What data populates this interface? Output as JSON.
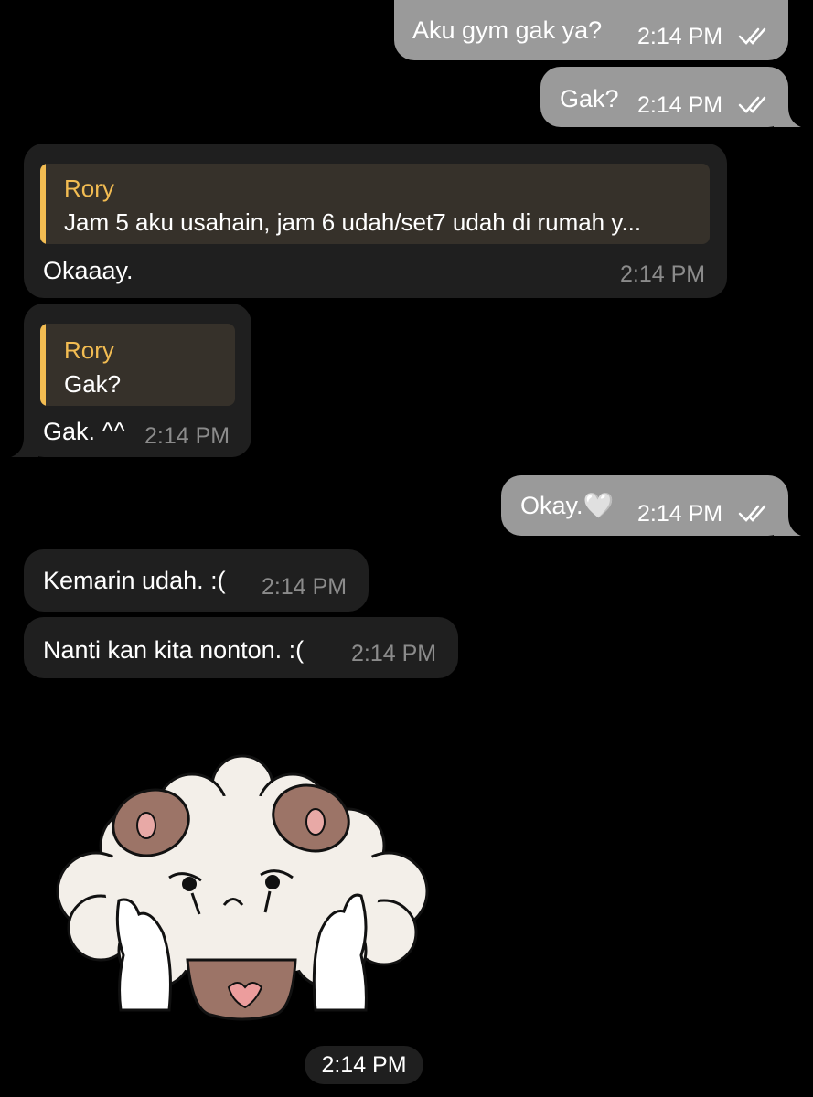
{
  "colors": {
    "background": "#000000",
    "outgoing_bubble": "#9a9a9a",
    "incoming_bubble": "#1f1f1f",
    "reply_accent": "#f2bc52",
    "reply_background": "#36312a",
    "incoming_time": "#8b8b8b"
  },
  "messages": [
    {
      "direction": "outgoing",
      "text": "Aku gym gak ya?",
      "time": "2:14 PM",
      "status_icon": "double-check-icon"
    },
    {
      "direction": "outgoing",
      "text": "Gak?",
      "time": "2:14 PM",
      "status_icon": "double-check-icon"
    },
    {
      "direction": "incoming",
      "reply": {
        "name": "Rory",
        "text": "Jam 5 aku usahain, jam 6 udah/set7 udah di rumah y..."
      },
      "text": "Okaaay.",
      "time": "2:14 PM"
    },
    {
      "direction": "incoming",
      "reply": {
        "name": "Rory",
        "text": "Gak?"
      },
      "text": "Gak. ^^",
      "time": "2:14 PM"
    },
    {
      "direction": "outgoing",
      "text": "Okay.🤍",
      "time": "2:14 PM",
      "status_icon": "double-check-icon"
    },
    {
      "direction": "incoming",
      "text": "Kemarin udah. :(",
      "time": "2:14 PM"
    },
    {
      "direction": "incoming",
      "text": "Nanti kan kita nonton. :(",
      "time": "2:14 PM"
    },
    {
      "direction": "incoming",
      "type": "sticker",
      "sticker": "crying-fluffy-dog-sticker",
      "time": "2:14 PM"
    }
  ]
}
